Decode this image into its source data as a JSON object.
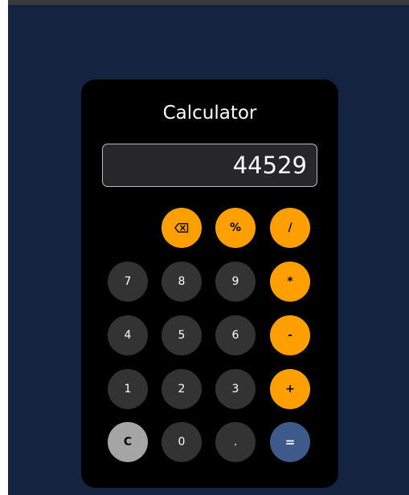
{
  "app": {
    "title": "Calculator"
  },
  "display": {
    "value": "44529"
  },
  "colors": {
    "page_background": "#142340",
    "panel": "#000000",
    "number_key": "#333333",
    "operator_key": "#ffa000",
    "clear_key": "#a5a5a5",
    "equals_key": "#3d5a8a"
  },
  "keys": {
    "backspace": {
      "icon": "backspace-icon"
    },
    "percent": "%",
    "divide": "/",
    "multiply": "*",
    "subtract": "-",
    "add": "+",
    "equals": "=",
    "clear": "C",
    "decimal": ".",
    "d0": "0",
    "d1": "1",
    "d2": "2",
    "d3": "3",
    "d4": "4",
    "d5": "5",
    "d6": "6",
    "d7": "7",
    "d8": "8",
    "d9": "9"
  }
}
